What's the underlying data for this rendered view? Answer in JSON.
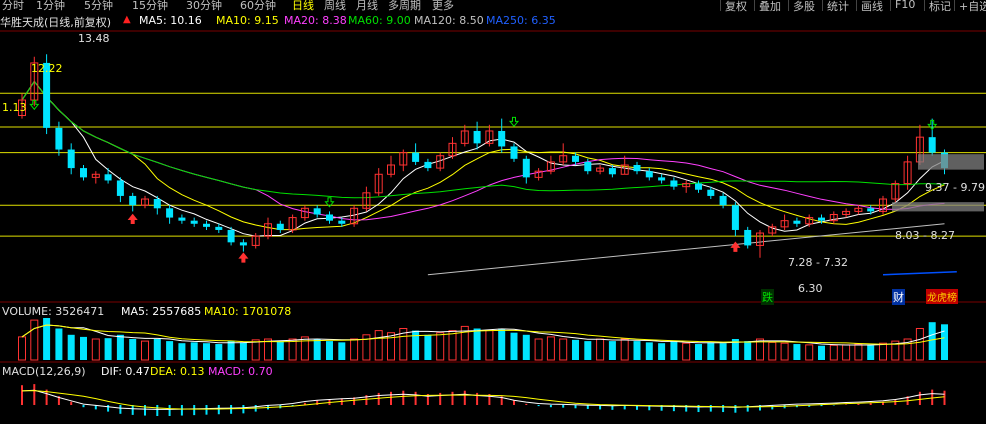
{
  "toolbar": {
    "timeframes": [
      "分时",
      "1分钟",
      "5分钟",
      "15分钟",
      "30分钟",
      "60分钟",
      "日线",
      "周线",
      "月线",
      "多周期",
      "更多"
    ],
    "active_index": 6,
    "buttons": [
      "复权",
      "叠加",
      "多股",
      "统计",
      "画线",
      "F10",
      "标记",
      "+自选"
    ]
  },
  "info": {
    "stock_name": "华胜天成(日线,前复权)",
    "ma5": "MA5: 10.16",
    "ma10": "MA10: 9.15",
    "ma20": "MA20: 8.38",
    "ma60": "MA60: 9.00",
    "ma120": "MA120: 8.50",
    "ma250": "MA250: 6.35"
  },
  "price_labels": {
    "high": "13.48",
    "left_high": "12.22",
    "left_level": "1.13",
    "range1": "9.37 - 9.79",
    "range2": "8.03 - 8.27",
    "range3": "7.28 - 7.32",
    "low": "6.30"
  },
  "badges": {
    "die": "跌",
    "cai": "财",
    "lhb": "龙虎榜"
  },
  "volume": {
    "label": "VOLUME: 3526471",
    "ma5": "MA5: 2557685",
    "ma10": "MA10: 1701078"
  },
  "macd": {
    "label": "MACD(12,26,9)",
    "dif": "DIF: 0.47",
    "dea": "DEA: 0.13",
    "macd": "MACD: 0.70"
  },
  "colors": {
    "up": "#ff3232",
    "down": "#00e4ff",
    "ma5": "#ffffff",
    "ma10": "#ffff00",
    "ma20": "#ff40ff",
    "ma60": "#00e000",
    "ma120": "#c0c0c0",
    "ma250": "#0050ff",
    "level": "#e0e000"
  },
  "chart_data": {
    "type": "candlestick",
    "price_range": [
      5.6,
      14.2
    ],
    "price_levels": [
      12.22,
      11.13,
      10.3,
      8.6,
      7.6
    ],
    "candles": [
      [
        11.5,
        12.2,
        11.4,
        12.0
      ],
      [
        12.0,
        13.4,
        11.8,
        13.2
      ],
      [
        13.2,
        13.48,
        10.9,
        11.1
      ],
      [
        11.1,
        11.3,
        10.2,
        10.4
      ],
      [
        10.4,
        10.6,
        9.6,
        9.8
      ],
      [
        9.8,
        9.9,
        9.4,
        9.5
      ],
      [
        9.5,
        9.7,
        9.3,
        9.6
      ],
      [
        9.6,
        9.8,
        9.3,
        9.4
      ],
      [
        9.4,
        9.5,
        8.7,
        8.9
      ],
      [
        8.9,
        9.0,
        8.4,
        8.6
      ],
      [
        8.6,
        8.9,
        8.5,
        8.8
      ],
      [
        8.8,
        8.9,
        8.3,
        8.5
      ],
      [
        8.5,
        8.6,
        8.0,
        8.2
      ],
      [
        8.2,
        8.3,
        8.0,
        8.1
      ],
      [
        8.1,
        8.2,
        7.9,
        8.0
      ],
      [
        8.0,
        8.1,
        7.8,
        7.9
      ],
      [
        7.9,
        8.0,
        7.7,
        7.8
      ],
      [
        7.8,
        7.9,
        7.3,
        7.4
      ],
      [
        7.4,
        7.5,
        7.1,
        7.3
      ],
      [
        7.3,
        7.7,
        7.2,
        7.6
      ],
      [
        7.6,
        8.2,
        7.5,
        8.0
      ],
      [
        8.0,
        8.1,
        7.7,
        7.8
      ],
      [
        7.8,
        8.3,
        7.7,
        8.2
      ],
      [
        8.2,
        8.6,
        8.1,
        8.5
      ],
      [
        8.5,
        8.6,
        8.2,
        8.3
      ],
      [
        8.3,
        8.4,
        8.0,
        8.1
      ],
      [
        8.1,
        8.2,
        7.9,
        8.0
      ],
      [
        8.0,
        8.6,
        7.9,
        8.5
      ],
      [
        8.5,
        9.2,
        8.4,
        9.0
      ],
      [
        9.0,
        9.8,
        8.9,
        9.6
      ],
      [
        9.6,
        10.2,
        9.5,
        9.9
      ],
      [
        9.9,
        10.4,
        9.7,
        10.3
      ],
      [
        10.3,
        10.6,
        9.9,
        10.0
      ],
      [
        10.0,
        10.1,
        9.7,
        9.8
      ],
      [
        9.8,
        10.3,
        9.7,
        10.2
      ],
      [
        10.2,
        10.8,
        10.1,
        10.6
      ],
      [
        10.6,
        11.2,
        10.5,
        11.0
      ],
      [
        11.0,
        11.3,
        10.4,
        10.6
      ],
      [
        10.6,
        11.2,
        10.5,
        11.0
      ],
      [
        11.0,
        11.4,
        10.3,
        10.5
      ],
      [
        10.5,
        10.6,
        10.0,
        10.1
      ],
      [
        10.1,
        10.2,
        9.3,
        9.5
      ],
      [
        9.5,
        9.8,
        9.4,
        9.7
      ],
      [
        9.7,
        10.2,
        9.6,
        10.0
      ],
      [
        10.0,
        10.6,
        9.9,
        10.2
      ],
      [
        10.2,
        10.3,
        9.9,
        10.0
      ],
      [
        10.0,
        10.1,
        9.6,
        9.7
      ],
      [
        9.7,
        9.9,
        9.6,
        9.8
      ],
      [
        9.8,
        9.9,
        9.5,
        9.6
      ],
      [
        9.6,
        10.2,
        9.6,
        9.9
      ],
      [
        9.9,
        10.0,
        9.6,
        9.7
      ],
      [
        9.7,
        9.8,
        9.4,
        9.5
      ],
      [
        9.5,
        9.6,
        9.3,
        9.4
      ],
      [
        9.4,
        9.5,
        9.1,
        9.2
      ],
      [
        9.2,
        9.4,
        9.0,
        9.3
      ],
      [
        9.3,
        9.4,
        9.0,
        9.1
      ],
      [
        9.1,
        9.2,
        8.8,
        8.9
      ],
      [
        8.9,
        9.0,
        8.5,
        8.6
      ],
      [
        8.6,
        8.7,
        7.6,
        7.8
      ],
      [
        7.8,
        7.9,
        7.2,
        7.3
      ],
      [
        7.3,
        7.8,
        6.9,
        7.7
      ],
      [
        7.7,
        8.0,
        7.6,
        7.9
      ],
      [
        7.9,
        8.3,
        7.8,
        8.1
      ],
      [
        8.1,
        8.2,
        7.9,
        8.0
      ],
      [
        8.0,
        8.3,
        7.9,
        8.2
      ],
      [
        8.2,
        8.3,
        8.0,
        8.1
      ],
      [
        8.1,
        8.4,
        8.0,
        8.3
      ],
      [
        8.3,
        8.5,
        8.2,
        8.4
      ],
      [
        8.4,
        8.6,
        8.3,
        8.5
      ],
      [
        8.5,
        8.6,
        8.3,
        8.4
      ],
      [
        8.4,
        8.9,
        8.3,
        8.8
      ],
      [
        8.8,
        9.4,
        8.7,
        9.3
      ],
      [
        9.3,
        10.2,
        9.1,
        10.0
      ],
      [
        10.0,
        11.2,
        9.9,
        10.8
      ],
      [
        10.8,
        11.4,
        10.2,
        10.3
      ],
      [
        10.3,
        10.4,
        9.6,
        9.8
      ]
    ],
    "volumes": [
      0.55,
      0.95,
      1.0,
      0.75,
      0.6,
      0.55,
      0.5,
      0.52,
      0.6,
      0.5,
      0.45,
      0.5,
      0.45,
      0.4,
      0.42,
      0.4,
      0.38,
      0.45,
      0.42,
      0.48,
      0.5,
      0.45,
      0.5,
      0.55,
      0.5,
      0.45,
      0.42,
      0.5,
      0.6,
      0.7,
      0.65,
      0.75,
      0.7,
      0.6,
      0.65,
      0.7,
      0.8,
      0.75,
      0.7,
      0.75,
      0.65,
      0.6,
      0.5,
      0.55,
      0.5,
      0.48,
      0.45,
      0.5,
      0.45,
      0.5,
      0.45,
      0.42,
      0.4,
      0.45,
      0.4,
      0.38,
      0.42,
      0.4,
      0.5,
      0.45,
      0.5,
      0.42,
      0.4,
      0.38,
      0.36,
      0.34,
      0.35,
      0.36,
      0.38,
      0.35,
      0.4,
      0.45,
      0.5,
      0.75,
      0.9,
      0.85
    ],
    "macd": [
      0.9,
      0.95,
      0.7,
      0.4,
      0.15,
      -0.1,
      -0.2,
      -0.3,
      -0.4,
      -0.45,
      -0.48,
      -0.5,
      -0.5,
      -0.48,
      -0.46,
      -0.44,
      -0.42,
      -0.4,
      -0.38,
      -0.3,
      -0.2,
      -0.15,
      -0.05,
      0.1,
      0.2,
      0.25,
      0.3,
      0.35,
      0.45,
      0.55,
      0.6,
      0.65,
      0.6,
      0.5,
      0.55,
      0.6,
      0.65,
      0.55,
      0.5,
      0.4,
      0.2,
      0.05,
      -0.05,
      -0.1,
      -0.12,
      -0.15,
      -0.18,
      -0.2,
      -0.22,
      -0.2,
      -0.22,
      -0.24,
      -0.26,
      -0.28,
      -0.3,
      -0.32,
      -0.3,
      -0.32,
      -0.35,
      -0.3,
      -0.25,
      -0.2,
      -0.15,
      -0.1,
      -0.08,
      -0.05,
      -0.02,
      0.02,
      0.05,
      0.1,
      0.15,
      0.25,
      0.4,
      0.6,
      0.7,
      0.65
    ]
  }
}
